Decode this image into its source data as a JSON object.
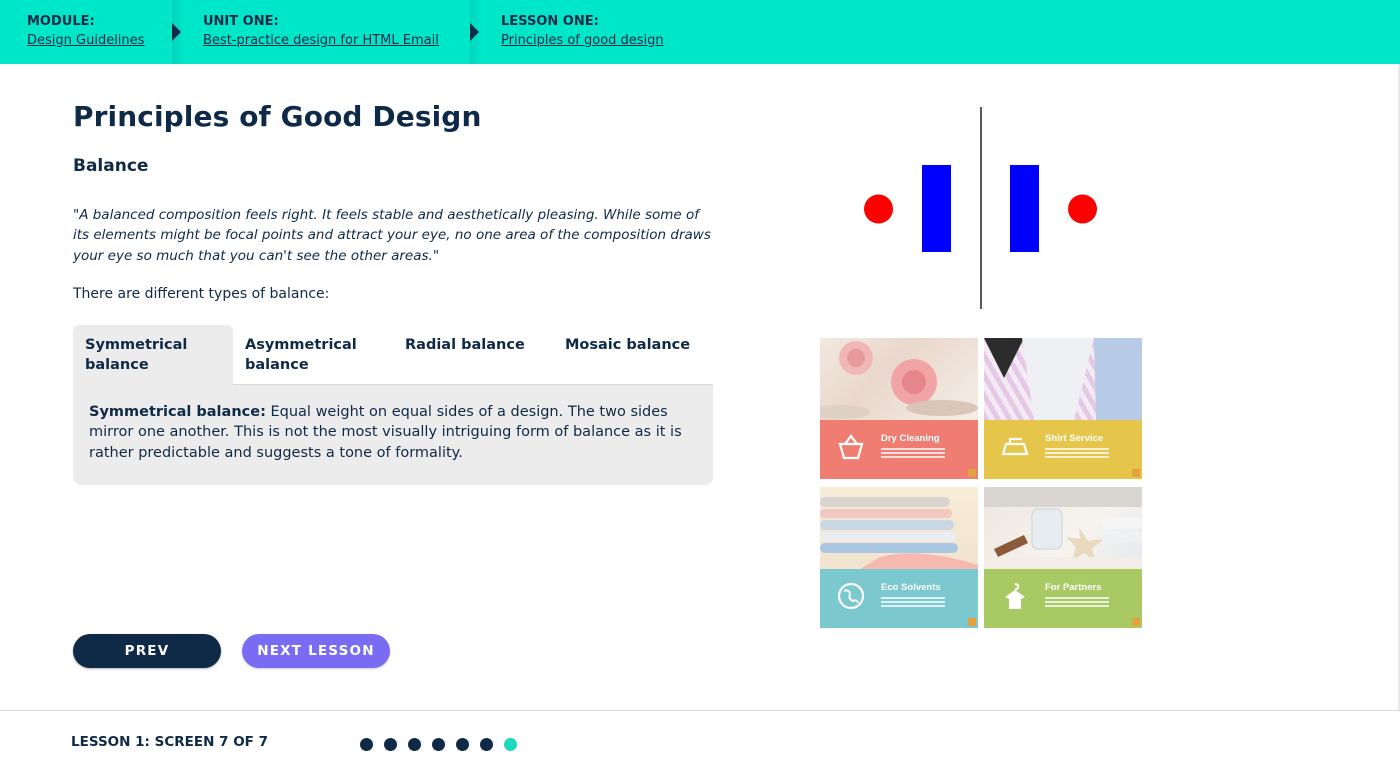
{
  "breadcrumb": {
    "module": {
      "label": "MODULE:",
      "link": "Design Guidelines"
    },
    "unit": {
      "label": "UNIT ONE:",
      "link": "Best-practice design for HTML Email"
    },
    "lesson": {
      "label": "LESSON ONE:",
      "link": "Principles of good design"
    }
  },
  "content": {
    "title": "Principles of Good Design",
    "subtitle": "Balance",
    "quote": "\"A balanced composition feels right. It feels stable and aesthetically pleasing. While some of its elements might be focal points and attract your eye, no one area of the composition draws your eye so much that you can't see the other areas.\"",
    "intro": "There are different types of balance:",
    "tabs": [
      {
        "label": "Symmetrical balance"
      },
      {
        "label": "Asymmetrical balance"
      },
      {
        "label": "Radial balance"
      },
      {
        "label": "Mosaic balance"
      }
    ],
    "panel": {
      "term": "Symmetrical balance:",
      "text": " Equal weight on equal sides of a design. The two sides mirror one another. This is not the most visually intriguing form of balance as it is rather predictable and suggests a tone of formality."
    }
  },
  "buttons": {
    "prev": "PREV",
    "next": "NEXT LESSON"
  },
  "footer": {
    "progress_label": "LESSON 1: SCREEN 7 OF 7",
    "total_screens": 7,
    "current_screen": 7
  },
  "tiles": [
    {
      "title": "Dry Cleaning",
      "color": "#ef7d72",
      "icon": "laundry-basket-icon"
    },
    {
      "title": "Shirt Service",
      "color": "#e6c64a",
      "icon": "iron-icon"
    },
    {
      "title": "Eco Solvents",
      "color": "#7cc8cf",
      "icon": "globe-icon"
    },
    {
      "title": "For Partners",
      "color": "#a8c963",
      "icon": "hanger-shirt-icon"
    }
  ],
  "colors": {
    "topbar": "#00e6c8",
    "navy": "#0f2a47",
    "accent_button": "#7a6cf2",
    "current_dot": "#1ed9bd",
    "figure_red": "#ff0000",
    "figure_blue": "#0000ff"
  }
}
